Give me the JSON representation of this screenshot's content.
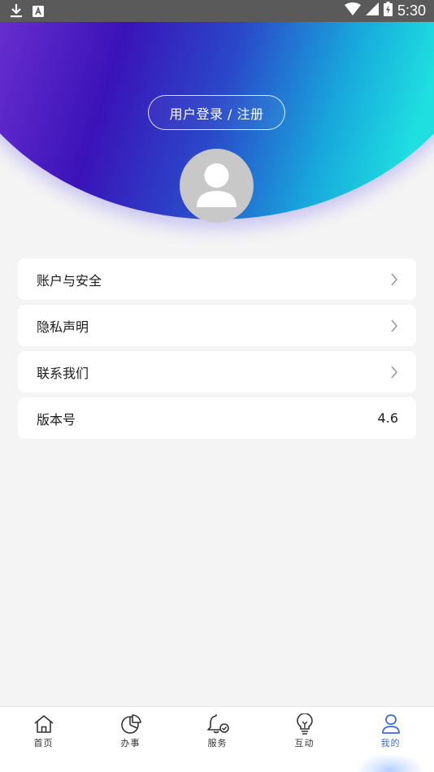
{
  "status_bar": {
    "time": "5:30",
    "icons": [
      "download-icon",
      "a-keyboard-icon",
      "wifi-icon",
      "signal-icon",
      "battery-icon"
    ]
  },
  "header": {
    "login_label": "用户登录 / 注册",
    "avatar_icon": "user-icon"
  },
  "menu": {
    "items": [
      {
        "label": "账户与安全",
        "value": ""
      },
      {
        "label": "隐私声明",
        "value": ""
      },
      {
        "label": "联系我们",
        "value": ""
      },
      {
        "label": "版本号",
        "value": "4.6"
      }
    ]
  },
  "bottom_nav": {
    "items": [
      {
        "label": "首页",
        "icon": "home-icon"
      },
      {
        "label": "办事",
        "icon": "pie-chart-icon"
      },
      {
        "label": "服务",
        "icon": "bell-check-icon"
      },
      {
        "label": "互动",
        "icon": "lightbulb-icon"
      },
      {
        "label": "我的",
        "icon": "person-icon"
      }
    ],
    "active": "我的"
  },
  "colors": {
    "accent": "#3c6be0",
    "page_bg": "#f4f4f4",
    "header_purple": "#4a1fc9",
    "header_cyan": "#1ed3de"
  }
}
